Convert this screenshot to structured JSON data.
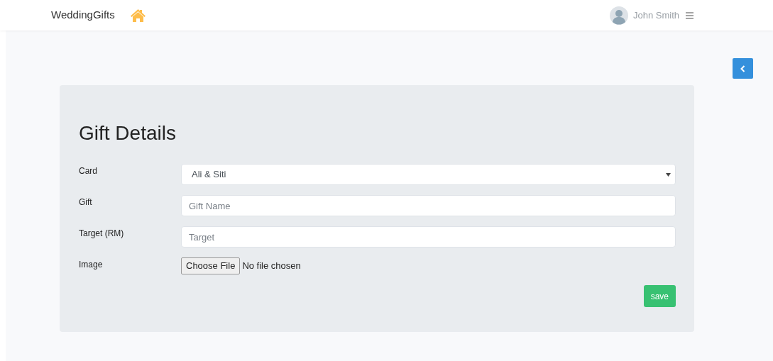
{
  "navbar": {
    "brand": "WeddingGifts",
    "user": "John Smith"
  },
  "form": {
    "title": "Gift Details",
    "fields": [
      {
        "kind": "select",
        "label": "Card",
        "value": "Ali & Siti"
      },
      {
        "kind": "text",
        "label": "Gift",
        "placeholder": "Gift Name"
      },
      {
        "kind": "text",
        "label": "Target (RM)",
        "placeholder": "Target"
      },
      {
        "kind": "file",
        "label": "Image",
        "button": "Choose File",
        "status": "No file chosen"
      }
    ],
    "submit": "save"
  }
}
